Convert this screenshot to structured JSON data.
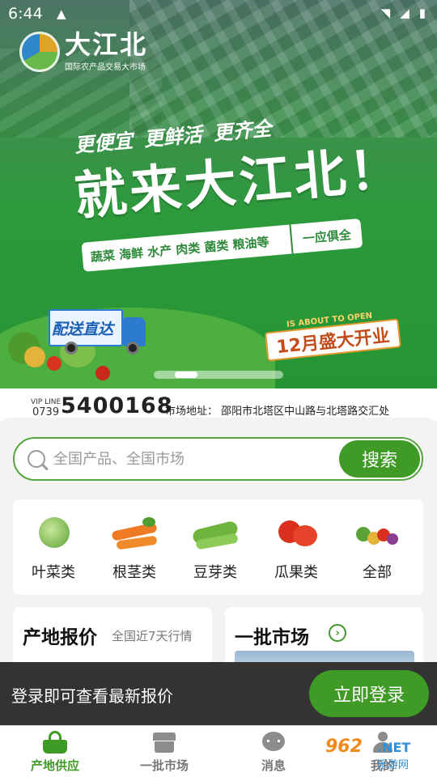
{
  "status_bar": {
    "time": "6:44"
  },
  "banner": {
    "logo_title": "大江北",
    "logo_subtitle": "国际农产品交易大市场",
    "slogans": [
      "更便宜",
      "更鲜活",
      "更齐全"
    ],
    "headline": "就来大江北！",
    "categories_line": "蔬菜 海鲜 水产 肉类 菌类 粮油等",
    "categories_tail": "一应俱全",
    "truck_label": "配送直达",
    "opening_en": "IS ABOUT TO OPEN",
    "opening_cn": "12月盛大开业",
    "carousel": {
      "count": 2,
      "active": 0
    }
  },
  "info": {
    "vip_label": "VIP LINE",
    "area_code": "0739",
    "phone": "5400168",
    "address": "市场地址：  邵阳市北塔区中山路与北塔路交汇处"
  },
  "search": {
    "placeholder": "全国产品、全国市场",
    "button": "搜索"
  },
  "categories": [
    {
      "label": "叶菜类",
      "icon": "cabbage-icon"
    },
    {
      "label": "根茎类",
      "icon": "carrot-icon"
    },
    {
      "label": "豆芽类",
      "icon": "peas-icon"
    },
    {
      "label": "瓜果类",
      "icon": "tomato-icon"
    },
    {
      "label": "全部",
      "icon": "mixed-vegetables-icon"
    }
  ],
  "panels": {
    "origin_price": {
      "title": "产地报价",
      "subtitle": "全国近7天行情"
    },
    "wholesale": {
      "title": "一批市场"
    }
  },
  "login_prompt": {
    "text": "登录即可查看最新报价",
    "button": "立即登录"
  },
  "tabs": [
    {
      "label": "产地供应",
      "icon": "basket-icon",
      "active": true
    },
    {
      "label": "一批市场",
      "icon": "store-icon",
      "active": false
    },
    {
      "label": "消息",
      "icon": "chat-icon",
      "active": false
    },
    {
      "label": "我的",
      "icon": "user-icon",
      "active": false
    }
  ],
  "watermark": {
    "number": "962",
    "net": ".NET",
    "name": "乐游网"
  },
  "colors": {
    "brand_green": "#3f9a26",
    "login_bar": "#333333",
    "phone_text": "#222222"
  }
}
